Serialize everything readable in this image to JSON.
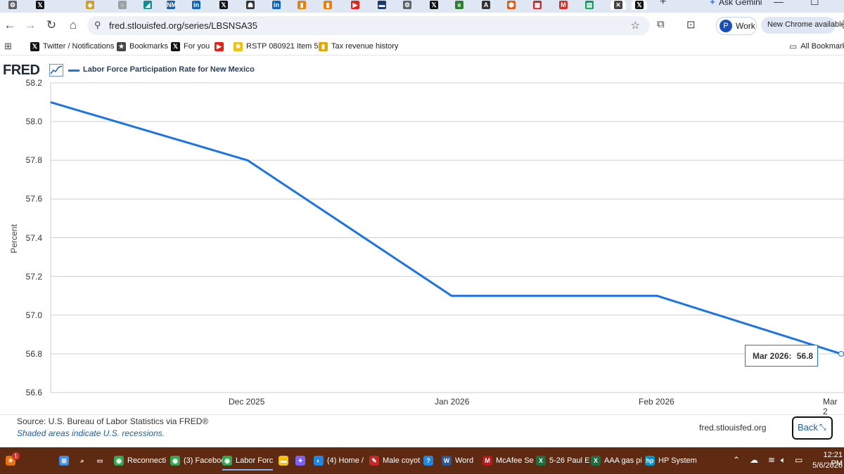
{
  "browser": {
    "tabs": [
      {
        "icon": "chrome-settings-icon",
        "color": "#5f6368",
        "glyph": "⚙"
      },
      {
        "icon": "x-icon",
        "color": "#111111",
        "glyph": "𝕏"
      },
      {
        "icon": "gold-tab-icon",
        "color": "#c9a227",
        "glyph": "◆"
      },
      {
        "icon": "generic-tab-icon",
        "color": "#9aa0a6",
        "glyph": "○"
      },
      {
        "icon": "teal-tab-icon",
        "color": "#0b8f8f",
        "glyph": "◢"
      },
      {
        "icon": "nm-tab-icon",
        "color": "#1a5fb4",
        "glyph": "NM"
      },
      {
        "icon": "linkedin-icon",
        "color": "#0a66c2",
        "glyph": "in"
      },
      {
        "icon": "x-icon",
        "color": "#111111",
        "glyph": "𝕏"
      },
      {
        "icon": "person-tab-icon",
        "color": "#333333",
        "glyph": "☗"
      },
      {
        "icon": "linkedin-icon",
        "color": "#0a66c2",
        "glyph": "in"
      },
      {
        "icon": "orange-tab-icon",
        "color": "#f57c00",
        "glyph": "▮"
      },
      {
        "icon": "orange-tab-icon",
        "color": "#f57c00",
        "glyph": "▮"
      },
      {
        "icon": "youtube-icon",
        "color": "#e62117",
        "glyph": "▶"
      },
      {
        "icon": "news-tab-icon",
        "color": "#1b3a6b",
        "glyph": "▬"
      },
      {
        "icon": "chrome-settings-icon",
        "color": "#5f6368",
        "glyph": "⚙"
      },
      {
        "icon": "x-icon",
        "color": "#111111",
        "glyph": "𝕏"
      },
      {
        "icon": "eia-tab-icon",
        "color": "#2e7d32",
        "glyph": "e"
      },
      {
        "icon": "a-tab-icon",
        "color": "#333333",
        "glyph": "A"
      },
      {
        "icon": "shield-tab-icon",
        "color": "#e8590c",
        "glyph": "⬢"
      },
      {
        "icon": "flag-tab-icon",
        "color": "#c62828",
        "glyph": "▦"
      },
      {
        "icon": "gmail-icon",
        "color": "#d93025",
        "glyph": "M"
      },
      {
        "icon": "chart-tab-icon",
        "color": "#0f9d58",
        "glyph": "▤"
      },
      {
        "icon": "close-icon",
        "color": "#444444",
        "glyph": "✕"
      },
      {
        "icon": "x-icon",
        "color": "#111111",
        "glyph": "𝕏"
      }
    ],
    "new_tab": "+",
    "ask_gemini": "Ask Gemini",
    "url": "fred.stlouisfed.org/series/LBSNSA35",
    "profile_initial": "P",
    "profile_label": "Work",
    "new_chrome": "New Chrome available"
  },
  "bookmarks": {
    "items": [
      {
        "label": "Twitter / Notifications",
        "icon": "x-icon",
        "color": "#111111",
        "glyph": "𝕏"
      },
      {
        "label": "Bookmarks",
        "icon": "star-icon",
        "color": "#444444",
        "glyph": "★"
      },
      {
        "label": "For you",
        "icon": "x-icon",
        "color": "#111111",
        "glyph": "𝕏"
      },
      {
        "label": "",
        "icon": "youtube-icon",
        "color": "#e62117",
        "glyph": "▶"
      },
      {
        "label": "RSTP 080921 Item 5...",
        "icon": "nm-flag-icon",
        "color": "#f4c20d",
        "glyph": "✸"
      },
      {
        "label": "Tax revenue history",
        "icon": "chart-bookmark-icon",
        "color": "#e0a800",
        "glyph": "▮"
      }
    ],
    "all_bookmarks": "All Bookmarks"
  },
  "fred": {
    "logo": "FRED",
    "legend": "Labor Force Participation Rate for New Mexico",
    "source": "Source: U.S. Bureau of Labor Statistics via FRED®",
    "shaded": "Shaded areas indicate U.S. recessions.",
    "site": "fred.stlouisfed.org",
    "back": "Back",
    "tooltip_label": "Mar 2026:",
    "tooltip_value": "56.8"
  },
  "chart_data": {
    "type": "line",
    "title": "Labor Force Participation Rate for New Mexico",
    "ylabel": "Percent",
    "xlabel": "",
    "x": [
      "Nov 2025",
      "Dec 2025",
      "Jan 2026",
      "Feb 2026",
      "Mar 2026"
    ],
    "x_tick_labels": [
      "Dec 2025",
      "Jan 2026",
      "Feb 2026",
      "Mar 2"
    ],
    "series": [
      {
        "name": "Labor Force Participation Rate for New Mexico",
        "values": [
          58.1,
          57.8,
          57.1,
          57.1,
          56.8
        ]
      }
    ],
    "ylim": [
      56.6,
      58.2
    ],
    "y_ticks": [
      "56.6",
      "56.8",
      "57.0",
      "57.2",
      "57.4",
      "57.6",
      "57.8",
      "58.0",
      "58.2"
    ],
    "grid": true,
    "line_color": "#1a73e8"
  },
  "taskbar": {
    "items": [
      {
        "label": "",
        "icon": "weather-icon",
        "color": "#e8710a",
        "glyph": "☀"
      },
      {
        "label": "",
        "icon": "windows-start-icon",
        "color": "#3b8eea",
        "glyph": "⊞"
      },
      {
        "label": "",
        "icon": "search-icon",
        "color": "#5e2b12",
        "glyph": "⌕"
      },
      {
        "label": "",
        "icon": "task-view-icon",
        "color": "#5e2b12",
        "glyph": "▭"
      },
      {
        "label": "Reconnecti",
        "icon": "chrome-icon",
        "color": "#34a853",
        "glyph": "◉"
      },
      {
        "label": "(3) Faceboo",
        "icon": "chrome-icon",
        "color": "#34a853",
        "glyph": "◉"
      },
      {
        "label": "Labor Forc",
        "icon": "chrome-icon",
        "color": "#34a853",
        "glyph": "◉"
      },
      {
        "label": "",
        "icon": "folder-icon",
        "color": "#f4c20d",
        "glyph": "▬"
      },
      {
        "label": "",
        "icon": "copilot-icon",
        "color": "#7b61ff",
        "glyph": "✦"
      },
      {
        "label": "(4) Home /",
        "icon": "edge-icon",
        "color": "#1e88e5",
        "glyph": "◐"
      },
      {
        "label": "Male coyot",
        "icon": "feather-icon",
        "color": "#c62828",
        "glyph": "✎"
      },
      {
        "label": "",
        "icon": "help-icon",
        "color": "#1e88e5",
        "glyph": "?"
      },
      {
        "label": "Word",
        "icon": "word-icon",
        "color": "#2b579a",
        "glyph": "W"
      },
      {
        "label": "McAfee Se",
        "icon": "mcafee-icon",
        "color": "#c01818",
        "glyph": "M"
      },
      {
        "label": "5-26 Paul E",
        "icon": "excel-icon",
        "color": "#1d6f42",
        "glyph": "X"
      },
      {
        "label": "AAA gas pi",
        "icon": "excel-icon",
        "color": "#1d6f42",
        "glyph": "X"
      },
      {
        "label": "HP System",
        "icon": "hp-icon",
        "color": "#0096d6",
        "glyph": "hp"
      }
    ],
    "notification_count": "1",
    "time": "12:21 PM",
    "date": "5/6/2026"
  }
}
